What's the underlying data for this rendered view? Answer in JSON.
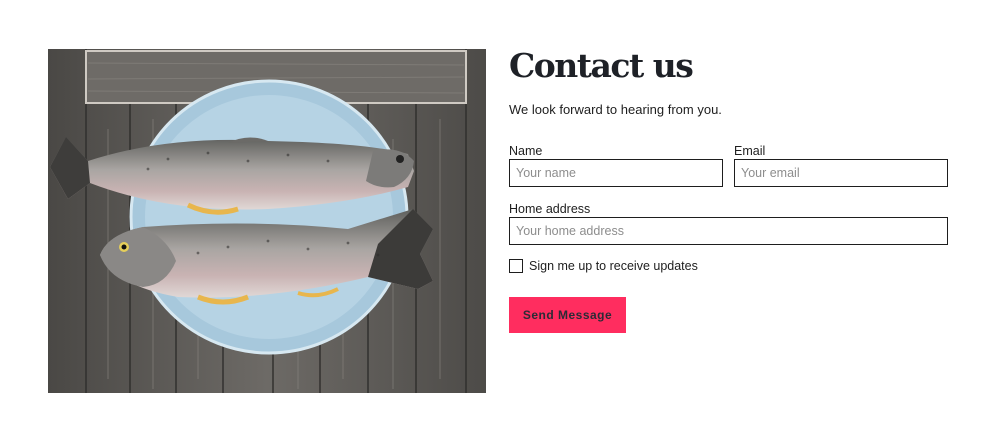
{
  "hero_image": {
    "icon": "fish-on-plate-photo"
  },
  "contact": {
    "title": "Contact us",
    "subtitle": "We look forward to hearing from you.",
    "name_label": "Name",
    "name_placeholder": "Your name",
    "email_label": "Email",
    "email_placeholder": "Your email",
    "address_label": "Home address",
    "address_placeholder": "Your home address",
    "updates_label": "Sign me up to receive updates",
    "updates_checked": false,
    "submit_label": "Send Message"
  },
  "colors": {
    "accent": "#ff2d5f",
    "text": "#1e1e1e",
    "placeholder": "#8d8d8d"
  }
}
